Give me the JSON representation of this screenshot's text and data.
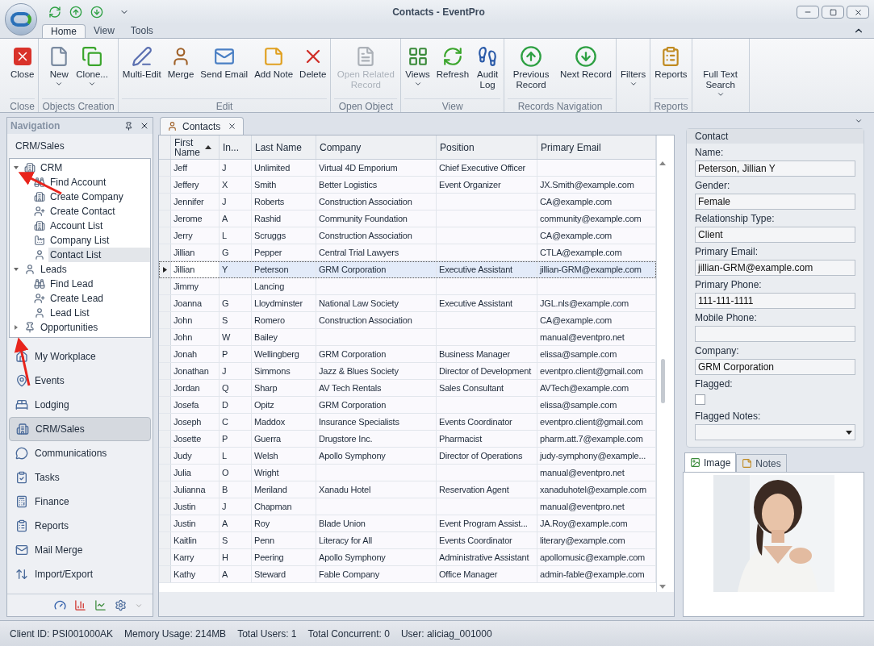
{
  "window": {
    "title": "Contacts - EventPro"
  },
  "ribbon_tabs": [
    {
      "label": "Home",
      "selected": true
    },
    {
      "label": "View",
      "selected": false
    },
    {
      "label": "Tools",
      "selected": false
    }
  ],
  "ribbon_groups": [
    {
      "buttons": [
        {
          "label": "Close",
          "dropdown": false,
          "disabled": false
        }
      ],
      "label": "Close"
    },
    {
      "buttons": [
        {
          "label": "New",
          "dropdown": true,
          "disabled": false
        },
        {
          "label": "Clone...",
          "dropdown": true,
          "disabled": false
        }
      ],
      "label": "Objects Creation"
    },
    {
      "buttons": [
        {
          "label": "Multi-Edit",
          "dropdown": false,
          "disabled": false
        },
        {
          "label": "Merge",
          "dropdown": false,
          "disabled": false
        },
        {
          "label": "Send Email",
          "dropdown": false,
          "disabled": false
        },
        {
          "label": "Add Note",
          "dropdown": false,
          "disabled": false
        },
        {
          "label": "Delete",
          "dropdown": false,
          "disabled": false
        }
      ],
      "label": "Edit"
    },
    {
      "buttons": [
        {
          "label": "Open Related Record",
          "dropdown": false,
          "disabled": true
        }
      ],
      "label": "Open Object"
    },
    {
      "buttons": [
        {
          "label": "Views",
          "dropdown": true,
          "disabled": false
        },
        {
          "label": "Refresh",
          "dropdown": false,
          "disabled": false
        },
        {
          "label": "Audit Log",
          "dropdown": false,
          "disabled": false
        }
      ],
      "label": "View"
    },
    {
      "buttons": [
        {
          "label": "Previous Record",
          "dropdown": false,
          "disabled": false
        },
        {
          "label": "Next Record",
          "dropdown": false,
          "disabled": false
        }
      ],
      "label": "Records Navigation"
    },
    {
      "buttons": [
        {
          "label": "Filters",
          "dropdown": true,
          "disabled": false
        }
      ]
    },
    {
      "buttons": [
        {
          "label": "Reports",
          "dropdown": false,
          "disabled": false
        }
      ],
      "label": "Reports"
    },
    {
      "buttons": [
        {
          "label": "Full Text Search",
          "dropdown": true,
          "disabled": false
        }
      ]
    }
  ],
  "navigation": {
    "title": "Navigation",
    "section": "CRM/Sales",
    "tree": [
      {
        "label": "CRM",
        "expanded": true,
        "selected": false,
        "children": [
          {
            "label": "Find Account",
            "selected": false
          },
          {
            "label": "Create Company",
            "selected": false
          },
          {
            "label": "Create Contact",
            "selected": false
          },
          {
            "label": "Account List",
            "selected": false
          },
          {
            "label": "Company List",
            "selected": false
          },
          {
            "label": "Contact List",
            "selected": true
          }
        ]
      },
      {
        "label": "Leads",
        "expanded": true,
        "selected": false,
        "children": [
          {
            "label": "Find Lead",
            "selected": false
          },
          {
            "label": "Create Lead",
            "selected": false
          },
          {
            "label": "Lead List",
            "selected": false
          }
        ]
      },
      {
        "label": "Opportunities",
        "expanded": false,
        "selected": false
      }
    ],
    "items": [
      {
        "label": "My Workplace",
        "selected": false
      },
      {
        "label": "Events",
        "selected": false
      },
      {
        "label": "Lodging",
        "selected": false
      },
      {
        "label": "CRM/Sales",
        "selected": true
      },
      {
        "label": "Communications",
        "selected": false
      },
      {
        "label": "Tasks",
        "selected": false
      },
      {
        "label": "Finance",
        "selected": false
      },
      {
        "label": "Reports",
        "selected": false
      },
      {
        "label": "Mail Merge",
        "selected": false
      },
      {
        "label": "Import/Export",
        "selected": false
      }
    ]
  },
  "document_tabs": [
    {
      "label": "Contacts",
      "selected": true
    }
  ],
  "table": {
    "columns": [
      {
        "label": "First Name",
        "sorted": true
      },
      {
        "label": "In...",
        "sorted": false
      },
      {
        "label": "Last Name",
        "sorted": false
      },
      {
        "label": "Company",
        "sorted": false
      },
      {
        "label": "Position",
        "sorted": false
      },
      {
        "label": "Primary Email",
        "sorted": false
      }
    ],
    "rows": [
      {
        "first": "Jeff",
        "initial": "J",
        "last": "Unlimited",
        "company": "Virtual 4D Emporium",
        "position": "Chief Executive Officer",
        "selected": false
      },
      {
        "first": "Jeffery",
        "initial": "X",
        "last": "Smith",
        "company": "Better Logistics",
        "position": "Event Organizer",
        "email": "JX.Smith@example.com",
        "selected": false
      },
      {
        "first": "Jennifer",
        "initial": "J",
        "last": "Roberts",
        "company": "Construction Association",
        "email": "CA@example.com",
        "selected": false
      },
      {
        "first": "Jerome",
        "initial": "A",
        "last": "Rashid",
        "company": "Community Foundation",
        "email": "community@example.com",
        "selected": false
      },
      {
        "first": "Jerry",
        "initial": "L",
        "last": "Scruggs",
        "company": "Construction Association",
        "email": "CA@example.com",
        "selected": false
      },
      {
        "first": "Jillian",
        "initial": "G",
        "last": "Pepper",
        "company": "Central Trial Lawyers",
        "email": "CTLA@example.com",
        "selected": false
      },
      {
        "first": "Jillian",
        "initial": "Y",
        "last": "Peterson",
        "company": "GRM Corporation",
        "position": "Executive Assistant",
        "email": "jillian-GRM@example.com",
        "selected": true
      },
      {
        "first": "Jimmy",
        "last": "Lancing",
        "selected": false
      },
      {
        "first": "Joanna",
        "initial": "G",
        "last": "Lloydminster",
        "company": "National Law Society",
        "position": "Executive Assistant",
        "email": "JGL.nls@example.com",
        "selected": false
      },
      {
        "first": "John",
        "initial": "S",
        "last": "Romero",
        "company": "Construction Association",
        "email": "CA@example.com",
        "selected": false
      },
      {
        "first": "John",
        "initial": "W",
        "last": "Bailey",
        "email": "manual@eventpro.net",
        "selected": false
      },
      {
        "first": "Jonah",
        "initial": "P",
        "last": "Wellingberg",
        "company": "GRM Corporation",
        "position": "Business Manager",
        "email": "elissa@sample.com",
        "selected": false
      },
      {
        "first": "Jonathan",
        "initial": "J",
        "last": "Simmons",
        "company": "Jazz & Blues Society",
        "position": "Director of Development",
        "email": "eventpro.client@gmail.com",
        "selected": false
      },
      {
        "first": "Jordan",
        "initial": "Q",
        "last": "Sharp",
        "company": "AV Tech Rentals",
        "position": "Sales Consultant",
        "email": "AVTech@example.com",
        "selected": false
      },
      {
        "first": "Josefa",
        "initial": "D",
        "last": "Opitz",
        "company": "GRM Corporation",
        "email": "elissa@sample.com",
        "selected": false
      },
      {
        "first": "Joseph",
        "initial": "C",
        "last": "Maddox",
        "company": "Insurance Specialists",
        "position": "Events Coordinator",
        "email": "eventpro.client@gmail.com",
        "selected": false
      },
      {
        "first": "Josette",
        "initial": "P",
        "last": "Guerra",
        "company": "Drugstore Inc.",
        "position": "Pharmacist",
        "email": "pharm.att.7@example.com",
        "selected": false
      },
      {
        "first": "Judy",
        "initial": "L",
        "last": "Welsh",
        "company": "Apollo Symphony",
        "position": "Director of Operations",
        "email": "judy-symphony@example...",
        "selected": false
      },
      {
        "first": "Julia",
        "initial": "O",
        "last": "Wright",
        "email": "manual@eventpro.net",
        "selected": false
      },
      {
        "first": "Julianna",
        "initial": "B",
        "last": "Meriland",
        "company": "Xanadu Hotel",
        "position": "Reservation Agent",
        "email": "xanaduhotel@example.com",
        "selected": false
      },
      {
        "first": "Justin",
        "initial": "J",
        "last": "Chapman",
        "email": "manual@eventpro.net",
        "selected": false
      },
      {
        "first": "Justin",
        "initial": "A",
        "last": "Roy",
        "company": "Blade Union",
        "position": "Event Program Assist...",
        "email": "JA.Roy@example.com",
        "selected": false
      },
      {
        "first": "Kaitlin",
        "initial": "S",
        "last": "Penn",
        "company": "Literacy for All",
        "position": "Events Coordinator",
        "email": "literary@example.com",
        "selected": false
      },
      {
        "first": "Karry",
        "initial": "H",
        "last": "Peering",
        "company": "Apollo Symphony",
        "position": "Administrative Assistant",
        "email": "apollomusic@example.com",
        "selected": false
      },
      {
        "first": "Kathy",
        "initial": "A",
        "last": "Steward",
        "company": "Fable Company",
        "position": "Office Manager",
        "email": "admin-fable@example.com",
        "selected": false
      }
    ]
  },
  "detail": {
    "title": "Contact",
    "fields": [
      {
        "kind": "text",
        "label": "Name:",
        "value": "Peterson, Jillian Y"
      },
      {
        "kind": "text",
        "label": "Gender:",
        "value": "Female"
      },
      {
        "kind": "text",
        "label": "Relationship Type:",
        "value": "Client"
      },
      {
        "kind": "text",
        "label": "Primary Email:",
        "value": "jillian-GRM@example.com"
      },
      {
        "kind": "text",
        "label": "Primary Phone:",
        "value": "111-111-1111"
      },
      {
        "kind": "text",
        "label": "Mobile Phone:"
      },
      {
        "kind": "text",
        "label": "Company:",
        "value": "GRM Corporation"
      },
      {
        "kind": "checkbox",
        "label": "Flagged:",
        "checked": false
      },
      {
        "kind": "dropdown",
        "label": "Flagged Notes:"
      }
    ],
    "tabs": [
      {
        "label": "Image",
        "selected": true
      },
      {
        "label": "Notes",
        "selected": false
      }
    ]
  },
  "status_bar": [
    "Client ID: PSI001000AK",
    "Memory Usage: 214MB",
    "Total Users: 1",
    "Total Concurrent: 0",
    "User: aliciag_001000"
  ]
}
